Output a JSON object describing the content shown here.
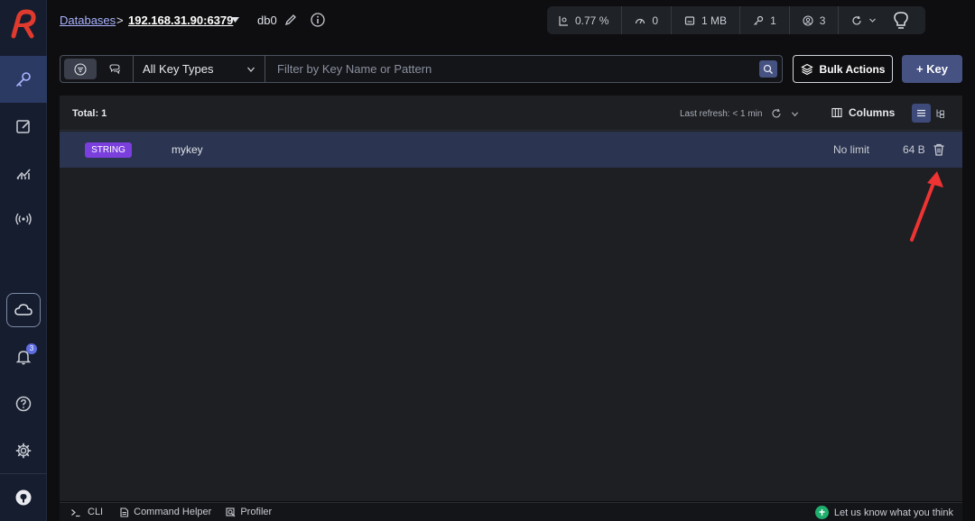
{
  "breadcrumb": {
    "databases": "Databases",
    "separator": ">",
    "host": "192.168.31.90:6379",
    "db": "db0"
  },
  "stats": [
    {
      "icon": "cpu-icon",
      "value": "0.77 %"
    },
    {
      "icon": "gauge-icon",
      "value": "0"
    },
    {
      "icon": "memory-icon",
      "value": "1 MB"
    },
    {
      "icon": "key-icon",
      "value": "1"
    },
    {
      "icon": "users-icon",
      "value": "3"
    }
  ],
  "filter": {
    "key_type": "All Key Types",
    "placeholder": "Filter by Key Name or Pattern"
  },
  "actions": {
    "bulk": "Bulk Actions",
    "add_key": "+ Key"
  },
  "table": {
    "total": "Total: 1",
    "last_refresh": "Last refresh: < 1 min",
    "columns_label": "Columns",
    "rows": [
      {
        "type": "STRING",
        "name": "mykey",
        "ttl": "No limit",
        "size": "64 B"
      }
    ]
  },
  "sidebar": {
    "notification_count": "3"
  },
  "bottom": {
    "cli": "CLI",
    "helper": "Command Helper",
    "profiler": "Profiler",
    "feedback": "Let us know what you think"
  },
  "colors": {
    "accent": "#465282",
    "string_badge": "#7a3fdc",
    "selected_row": "#2b3450",
    "annotation_arrow": "#ee3333"
  }
}
